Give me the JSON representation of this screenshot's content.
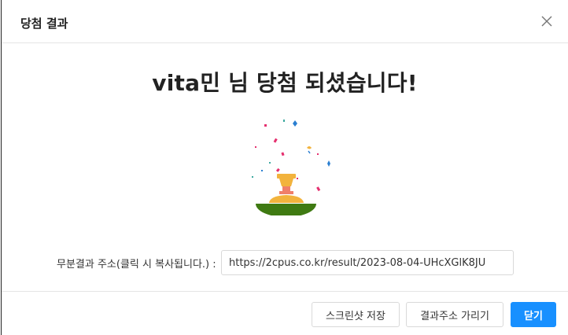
{
  "dialog": {
    "title": "당첨 결과",
    "close_icon": "close-icon"
  },
  "main": {
    "headline": "vita민 님 당첨 되셨습니다!",
    "illustration": "trophy-confetti-icon"
  },
  "result_url": {
    "label": "무분결과 주소(클릭 시 복사됩니다.) :",
    "value": "https://2cpus.co.kr/result/2023-08-04-UHcXGlK8JU"
  },
  "footer": {
    "screenshot_label": "스크린샷 저장",
    "hide_url_label": "결과주소 가리기",
    "close_label": "닫기"
  },
  "colors": {
    "primary": "#1890ff",
    "trophy_gold": "#f2b33d",
    "grass": "#3f7a12"
  }
}
